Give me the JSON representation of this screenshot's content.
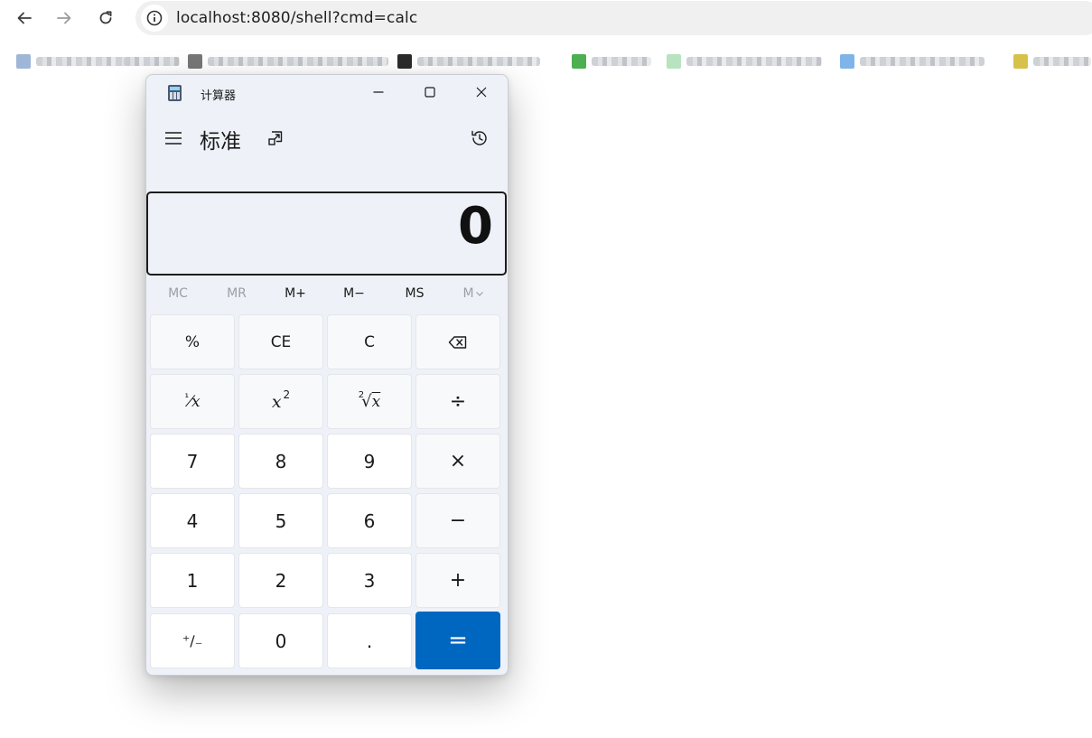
{
  "browser": {
    "url": "localhost:8080/shell?cmd=calc",
    "back_icon": "arrow-left-icon",
    "forward_icon": "arrow-right-icon",
    "reload_icon": "reload-icon",
    "site_info_icon": "info-icon",
    "bookmarks_blurred": true,
    "bookmark_icon_colors": [
      "#9fb7d6",
      "#777777",
      "#2b2b2b",
      "#4caf50",
      "#b7e3c0",
      "#7fb4e8",
      "#d6c24a"
    ]
  },
  "window": {
    "title": "计算器",
    "minimize_icon": "minimize-icon",
    "maximize_icon": "maximize-icon",
    "close_icon": "close-icon"
  },
  "calculator": {
    "mode": "标准",
    "display_value": "0",
    "menu_icon": "hamburger-icon",
    "keep_on_top_icon": "keep-on-top-icon",
    "history_icon": "history-icon",
    "memory": [
      {
        "label": "MC",
        "enabled": false
      },
      {
        "label": "MR",
        "enabled": false
      },
      {
        "label": "M+",
        "enabled": true
      },
      {
        "label": "M−",
        "enabled": true
      },
      {
        "label": "MS",
        "enabled": true
      },
      {
        "label": "M",
        "enabled": false
      }
    ],
    "keys": {
      "percent": "%",
      "ce": "CE",
      "c": "C",
      "reciprocal_num": "¹",
      "reciprocal_den": "⁄x",
      "square_base": "x",
      "square_exp": "2",
      "sqrt_index": "2",
      "sqrt_sign": "√",
      "sqrt_var": "x",
      "divide": "÷",
      "multiply": "×",
      "minus": "−",
      "plus": "+",
      "equals": "=",
      "seven": "7",
      "eight": "8",
      "nine": "9",
      "four": "4",
      "five": "5",
      "six": "6",
      "one": "1",
      "two": "2",
      "three": "3",
      "negate": "⁺∕₋",
      "zero": "0",
      "decimal": ".",
      "backspace_icon": "backspace-icon"
    },
    "accent_color": "#0067c0"
  }
}
